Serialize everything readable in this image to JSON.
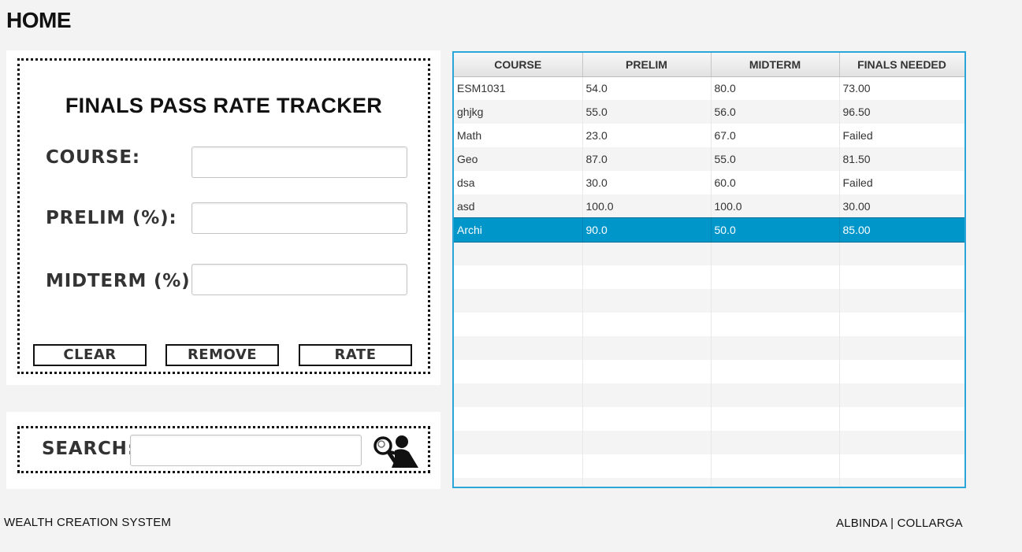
{
  "page": {
    "title": "HOME"
  },
  "form": {
    "heading": "FINALS PASS RATE TRACKER",
    "course_label": "COURSE:",
    "course_value": "",
    "prelim_label": "PRELIM (%):",
    "prelim_value": "",
    "midterm_label": "MIDTERM (%):",
    "midterm_value": "",
    "clear_label": "CLEAR",
    "remove_label": "REMOVE",
    "rate_label": "RATE"
  },
  "search": {
    "label": "SEARCH:",
    "value": "",
    "icon": "search-person-icon"
  },
  "table": {
    "columns": [
      "COURSE",
      "PRELIM",
      "MIDTERM",
      "FINALS NEEDED"
    ],
    "rows": [
      [
        "ESM1031",
        "54.0",
        "80.0",
        "73.00"
      ],
      [
        "ghjkg",
        "55.0",
        "56.0",
        "96.50"
      ],
      [
        "Math",
        "23.0",
        "67.0",
        "Failed"
      ],
      [
        "Geo",
        "87.0",
        "55.0",
        "81.50"
      ],
      [
        "dsa",
        "30.0",
        "60.0",
        "Failed"
      ],
      [
        "asd",
        "100.0",
        "100.0",
        "30.00"
      ],
      [
        "Archi",
        "90.0",
        "50.0",
        "85.00"
      ]
    ],
    "selected_row": 6,
    "empty_rows": 11,
    "accent_color": "#2aa6d8",
    "selection_color": "#0096c9"
  },
  "footer": {
    "left": "WEALTH CREATION SYSTEM",
    "right": "ALBINDA | COLLARGA"
  }
}
